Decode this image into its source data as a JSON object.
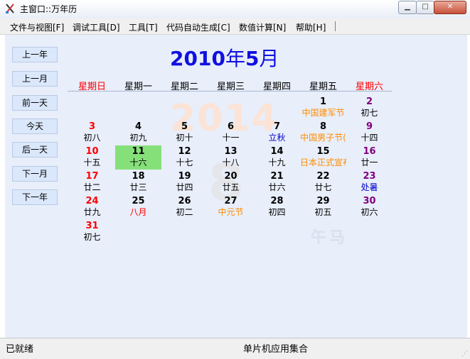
{
  "window": {
    "title": "主窗口::万年历"
  },
  "colors": {
    "red": "#ff0000",
    "purple": "#800080",
    "orange": "#ff8c00",
    "blue": "#0000c8",
    "black": "#000000",
    "today_bg": "#86e07a"
  },
  "menu": [
    "文件与视图[F]",
    "调试工具[D]",
    "工具[T]",
    "代码自动生成[C]",
    "数值计算[N]",
    "帮助[H]"
  ],
  "nav": [
    "上一年",
    "上一月",
    "前一天",
    "今天",
    "后一天",
    "下一月",
    "下一年"
  ],
  "header": {
    "year": "2010",
    "year_char": "年",
    "month": "5",
    "month_char": "月"
  },
  "watermark": {
    "year": "2014",
    "month": "8",
    "zodiac": "午马"
  },
  "weekdays": [
    {
      "label": "星期日",
      "color": "#ff0000"
    },
    {
      "label": "星期一",
      "color": "#000000"
    },
    {
      "label": "星期二",
      "color": "#000000"
    },
    {
      "label": "星期三",
      "color": "#000000"
    },
    {
      "label": "星期四",
      "color": "#000000"
    },
    {
      "label": "星期五",
      "color": "#000000"
    },
    {
      "label": "星期六",
      "color": "#ff0000"
    }
  ],
  "days": [
    {
      "d": "1",
      "sub": "中国建军节",
      "row": 0,
      "col": 5,
      "numc": "#000000",
      "subc": "#ff8c00"
    },
    {
      "d": "2",
      "sub": "初七",
      "row": 0,
      "col": 6,
      "numc": "#800080",
      "subc": "#000000"
    },
    {
      "d": "3",
      "sub": "初八",
      "row": 1,
      "col": 0,
      "numc": "#ff0000",
      "subc": "#000000"
    },
    {
      "d": "4",
      "sub": "初九",
      "row": 1,
      "col": 1,
      "numc": "#000000",
      "subc": "#000000"
    },
    {
      "d": "5",
      "sub": "初十",
      "row": 1,
      "col": 2,
      "numc": "#000000",
      "subc": "#000000"
    },
    {
      "d": "6",
      "sub": "十一",
      "row": 1,
      "col": 3,
      "numc": "#000000",
      "subc": "#000000"
    },
    {
      "d": "7",
      "sub": "立秋",
      "row": 1,
      "col": 4,
      "numc": "#000000",
      "subc": "#0000c8"
    },
    {
      "d": "8",
      "sub": "中国男子节(",
      "row": 1,
      "col": 5,
      "numc": "#000000",
      "subc": "#ff8c00"
    },
    {
      "d": "9",
      "sub": "十四",
      "row": 1,
      "col": 6,
      "numc": "#800080",
      "subc": "#000000"
    },
    {
      "d": "10",
      "sub": "十五",
      "row": 2,
      "col": 0,
      "numc": "#ff0000",
      "subc": "#000000"
    },
    {
      "d": "11",
      "sub": "十六",
      "row": 2,
      "col": 1,
      "numc": "#000000",
      "subc": "#000000",
      "today": true
    },
    {
      "d": "12",
      "sub": "十七",
      "row": 2,
      "col": 2,
      "numc": "#000000",
      "subc": "#000000"
    },
    {
      "d": "13",
      "sub": "十八",
      "row": 2,
      "col": 3,
      "numc": "#000000",
      "subc": "#000000"
    },
    {
      "d": "14",
      "sub": "十九",
      "row": 2,
      "col": 4,
      "numc": "#000000",
      "subc": "#000000"
    },
    {
      "d": "15",
      "sub": "日本正式宣布",
      "row": 2,
      "col": 5,
      "numc": "#000000",
      "subc": "#ff8c00"
    },
    {
      "d": "16",
      "sub": "廿一",
      "row": 2,
      "col": 6,
      "numc": "#800080",
      "subc": "#000000"
    },
    {
      "d": "17",
      "sub": "廿二",
      "row": 3,
      "col": 0,
      "numc": "#ff0000",
      "subc": "#000000"
    },
    {
      "d": "18",
      "sub": "廿三",
      "row": 3,
      "col": 1,
      "numc": "#000000",
      "subc": "#000000"
    },
    {
      "d": "19",
      "sub": "廿四",
      "row": 3,
      "col": 2,
      "numc": "#000000",
      "subc": "#000000"
    },
    {
      "d": "20",
      "sub": "廿五",
      "row": 3,
      "col": 3,
      "numc": "#000000",
      "subc": "#000000"
    },
    {
      "d": "21",
      "sub": "廿六",
      "row": 3,
      "col": 4,
      "numc": "#000000",
      "subc": "#000000"
    },
    {
      "d": "22",
      "sub": "廿七",
      "row": 3,
      "col": 5,
      "numc": "#000000",
      "subc": "#000000"
    },
    {
      "d": "23",
      "sub": "处暑",
      "row": 3,
      "col": 6,
      "numc": "#800080",
      "subc": "#0000c8"
    },
    {
      "d": "24",
      "sub": "廿九",
      "row": 4,
      "col": 0,
      "numc": "#ff0000",
      "subc": "#000000"
    },
    {
      "d": "25",
      "sub": "八月",
      "row": 4,
      "col": 1,
      "numc": "#000000",
      "subc": "#ff0000"
    },
    {
      "d": "26",
      "sub": "初二",
      "row": 4,
      "col": 2,
      "numc": "#000000",
      "subc": "#000000"
    },
    {
      "d": "27",
      "sub": "中元节",
      "row": 4,
      "col": 3,
      "numc": "#000000",
      "subc": "#ff8c00"
    },
    {
      "d": "28",
      "sub": "初四",
      "row": 4,
      "col": 4,
      "numc": "#000000",
      "subc": "#000000"
    },
    {
      "d": "29",
      "sub": "初五",
      "row": 4,
      "col": 5,
      "numc": "#000000",
      "subc": "#000000"
    },
    {
      "d": "30",
      "sub": "初六",
      "row": 4,
      "col": 6,
      "numc": "#800080",
      "subc": "#000000"
    },
    {
      "d": "31",
      "sub": "初七",
      "row": 5,
      "col": 0,
      "numc": "#ff0000",
      "subc": "#000000"
    }
  ],
  "status": {
    "left": "已就绪",
    "center": "单片机应用集合"
  }
}
